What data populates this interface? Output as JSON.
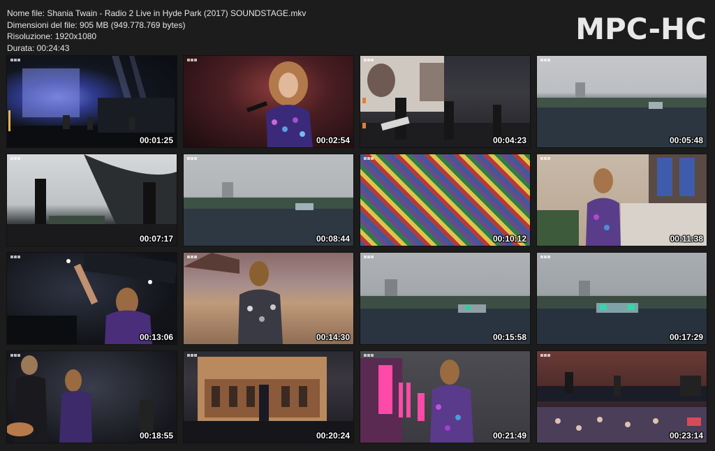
{
  "info": {
    "filename": "Nome file: Shania Twain - Radio 2 Live in Hyde Park (2017) SOUNDSTAGE.mkv",
    "filesize": "Dimensioni del file: 905 MB (949.778.769 bytes)",
    "resolution": "Risoluzione: 1920x1080",
    "duration": "Durata: 00:24:43"
  },
  "brand": "MPC-HC",
  "thumbnails": [
    {
      "time": "00:01:25",
      "scene": "stage-dark"
    },
    {
      "time": "00:02:54",
      "scene": "red-sparkle"
    },
    {
      "time": "00:04:23",
      "scene": "guitar"
    },
    {
      "time": "00:05:48",
      "scene": "crowd-sky"
    },
    {
      "time": "00:07:17",
      "scene": "silhouette"
    },
    {
      "time": "00:08:44",
      "scene": "wide-crowd"
    },
    {
      "time": "00:10:12",
      "scene": "colorful"
    },
    {
      "time": "00:11:38",
      "scene": "window"
    },
    {
      "time": "00:13:06",
      "scene": "point"
    },
    {
      "time": "00:14:30",
      "scene": "desert"
    },
    {
      "time": "00:15:58",
      "scene": "park"
    },
    {
      "time": "00:17:29",
      "scene": "park2"
    },
    {
      "time": "00:18:55",
      "scene": "band"
    },
    {
      "time": "00:20:24",
      "scene": "palace"
    },
    {
      "time": "00:21:49",
      "scene": "pink"
    },
    {
      "time": "00:23:14",
      "scene": "final"
    }
  ]
}
